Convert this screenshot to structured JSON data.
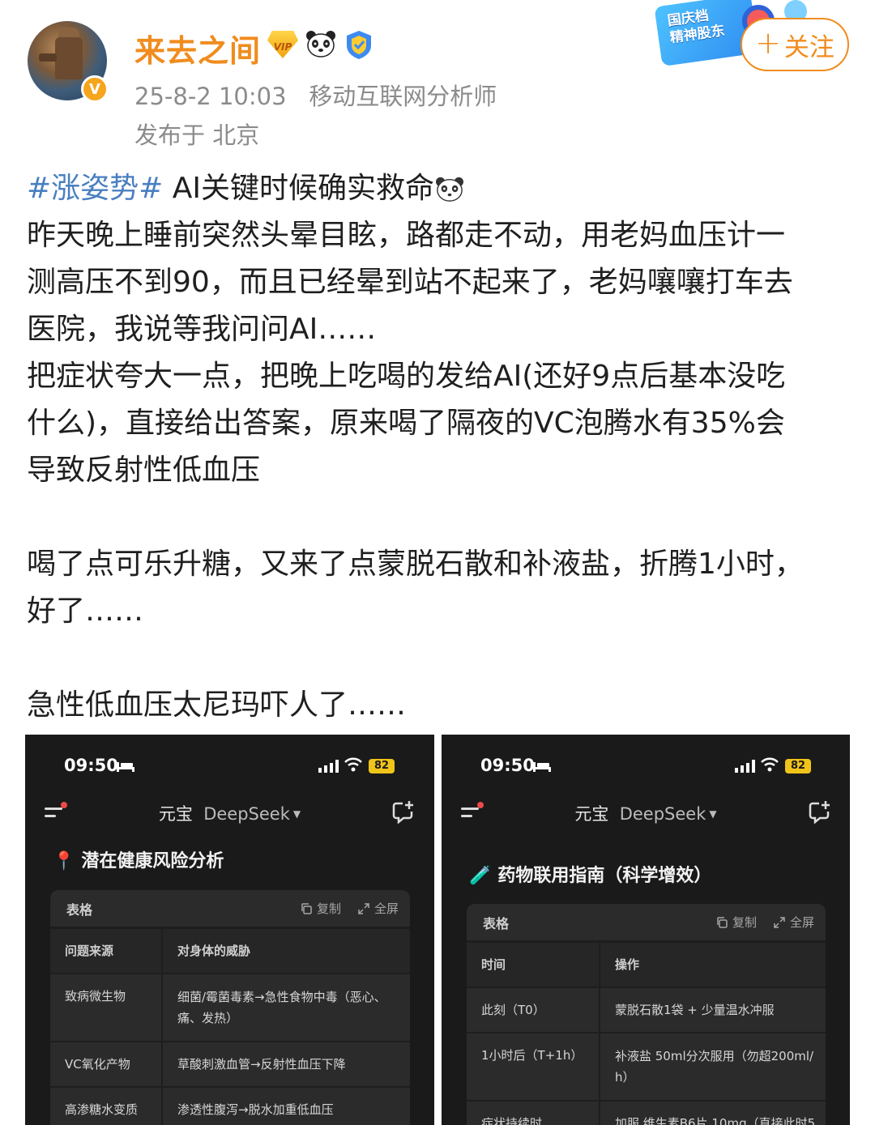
{
  "header": {
    "username": "来去之间",
    "vip_badge": "VIP",
    "timestamp": "25-8-2 10:03",
    "user_title": "移动互联网分析师",
    "location": "发布于 北京",
    "follow_label": "关注",
    "promo_badge_line1": "国庆档",
    "promo_badge_line2": "精神股东",
    "avatar_badge": "V",
    "accent_color": "#f08c1d"
  },
  "post": {
    "hashtag": "#涨姿势#",
    "line1": " AI关键时候确实救命",
    "line2": "昨天晚上睡前突然头晕目眩，路都走不动，用老妈血压计一",
    "line3": "测高压不到90，而且已经晕到站不起来了，老妈嚷嚷打车去",
    "line4": "医院，我说等我问问AI……",
    "line5": "把症状夸大一点，把晚上吃喝的发给AI(还好9点后基本没吃",
    "line6": "什么)，直接给出答案，原来喝了隔夜的VC泡腾水有35%会",
    "line7": "导致反射性低血压",
    "line8": "喝了点可乐升糖，又来了点蒙脱石散和补液盐，折腾1小时，",
    "line9": "好了……",
    "line10": "急性低血压太尼玛吓人了……",
    "hashtag_color": "#4a7fc1"
  },
  "screens": [
    {
      "time": "09:50",
      "battery": "82",
      "app_name": "元宝",
      "model_name": "DeepSeek",
      "section_icon": "📍",
      "section_title": "潜在健康风险分析",
      "table_label": "表格",
      "copy_label": "复制",
      "fullscreen_label": "全屏",
      "columns": [
        "问题来源",
        "对身体的威胁"
      ],
      "rows": [
        [
          "致病微生物",
          "细菌/霉菌毒素→急性食物中毒（恶心、",
          "痛、发热）"
        ],
        [
          "VC氧化产物",
          "草酸刺激血管→反射性血压下降",
          ""
        ],
        [
          "高渗糖水变质",
          "渗透性腹泻→脱水加重低血压",
          ""
        ]
      ]
    },
    {
      "time": "09:50",
      "battery": "82",
      "app_name": "元宝",
      "model_name": "DeepSeek",
      "section_icon": "🧪",
      "section_title": "药物联用指南（科学增效）",
      "table_label": "表格",
      "copy_label": "复制",
      "fullscreen_label": "全屏",
      "columns": [
        "时间",
        "操作"
      ],
      "rows": [
        [
          "此刻（T0）",
          "蒙脱石散1袋 + 少量温水冲服",
          ""
        ],
        [
          "1小时后（T+1h）",
          "补液盐 50ml分次服用（勿超200ml/",
          "h）"
        ],
        [
          "症状持续时",
          "加服 维生素B6片 10mg（直接此时5",
          ""
        ]
      ]
    }
  ]
}
